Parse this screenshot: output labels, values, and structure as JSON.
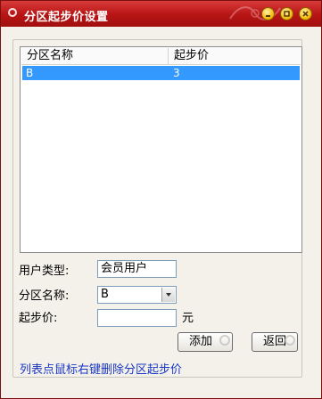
{
  "window": {
    "title": "分区起步价设置"
  },
  "list": {
    "columns": [
      "分区名称",
      "起步价"
    ],
    "rows": [
      {
        "name": "B",
        "price": "3",
        "selected": true
      }
    ]
  },
  "form": {
    "user_type_label": "用户类型:",
    "user_type_value": "会员用户",
    "zone_label": "分区名称:",
    "zone_value": "B",
    "price_label": "起步价:",
    "price_value": "",
    "unit": "元"
  },
  "buttons": {
    "add": "添加",
    "back": "返回"
  },
  "hint": "列表点鼠标右键删除分区起步价",
  "colors": {
    "titlebar": "#b71414",
    "selection": "#3399ff",
    "hint": "#1a37c4"
  }
}
